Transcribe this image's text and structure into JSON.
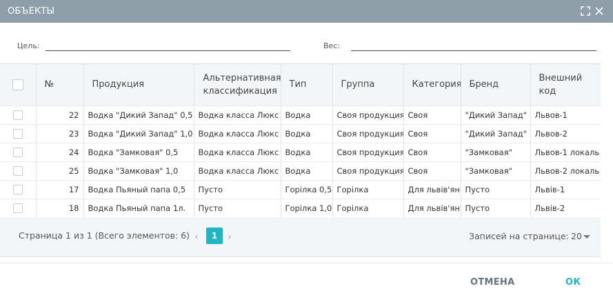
{
  "window": {
    "title": "ОБЪЕКТЫ"
  },
  "filters": {
    "goal_label": "Цель:",
    "goal_value": "",
    "weight_label": "Вес:",
    "weight_value": ""
  },
  "table": {
    "columns": [
      "№",
      "Продукция",
      "Альтернативная классификация",
      "Тип",
      "Группа",
      "Категория",
      "Бренд",
      "Внешний код"
    ],
    "rows": [
      [
        "22",
        "Водка \"Дикий Запад\" 0,5",
        "Водка класса Люкс",
        "Водка",
        "Своя продукция",
        "Своя",
        "\"Дикий Запад\"",
        "Львов-1"
      ],
      [
        "23",
        "Водка \"Дикий Запад\" 1,0",
        "Водка класса Люкс",
        "Водка",
        "Своя продукция",
        "Своя",
        "\"Дикий Запад\"",
        "Львов-2"
      ],
      [
        "24",
        "Водка \"Замковая\" 0,5",
        "Водка класса Люкс",
        "Водка",
        "Своя продукция",
        "Своя",
        "\"Замковая\"",
        "Львов-1 локаль"
      ],
      [
        "25",
        "Водка \"Замковая\" 1,0",
        "Водка класса Люкс",
        "Водка",
        "Своя продукция",
        "Своя",
        "\"Замковая\"",
        "Львов-2 локаль"
      ],
      [
        "17",
        "Водка Пьяный папа 0,5",
        "Пусто",
        "Горілка 0,5",
        "Горілка",
        "Для львів'ян",
        "Пусто",
        "Львів-1"
      ],
      [
        "18",
        "Водка Пьяный папа 1л.",
        "Пусто",
        "Горілка 1,0",
        "Горілка",
        "Для львів'ян",
        "Пусто",
        "Львів-2"
      ]
    ]
  },
  "pager": {
    "info": "Страница 1 из 1 (Всего элементов: 6)",
    "current_page": "1",
    "prev": "‹",
    "next": "›",
    "per_page_label": "Записей на странице:",
    "per_page_value": "20"
  },
  "footer": {
    "cancel_label": "ОТМЕНА",
    "ok_label": "ОК"
  },
  "colors": {
    "titlebar": "#8f9fa9",
    "accent": "#1fb5c5",
    "header_bg": "#f3f6f8"
  }
}
